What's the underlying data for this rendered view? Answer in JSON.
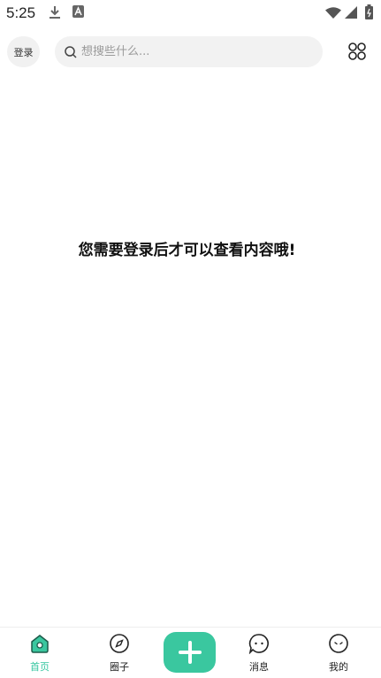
{
  "status_bar": {
    "time": "5:25",
    "icons": [
      "download-icon",
      "a-icon",
      "wifi-icon",
      "signal-icon",
      "battery-icon"
    ]
  },
  "header": {
    "login_label": "登录",
    "search": {
      "placeholder": "想搜些什么..."
    },
    "apps_icon": "apps-grid-icon"
  },
  "main": {
    "message": "您需要登录后才可以查看内容哦!"
  },
  "bottom_nav": {
    "items": [
      {
        "label": "首页",
        "icon": "home-icon",
        "active": true
      },
      {
        "label": "圈子",
        "icon": "compass-icon",
        "active": false
      },
      {
        "label": "",
        "icon": "plus-icon",
        "active": false
      },
      {
        "label": "消息",
        "icon": "message-icon",
        "active": false
      },
      {
        "label": "我的",
        "icon": "profile-icon",
        "active": false
      }
    ]
  },
  "colors": {
    "accent": "#3ac79f",
    "active_label": "#35c6a0",
    "search_bg": "#f2f2f2"
  }
}
